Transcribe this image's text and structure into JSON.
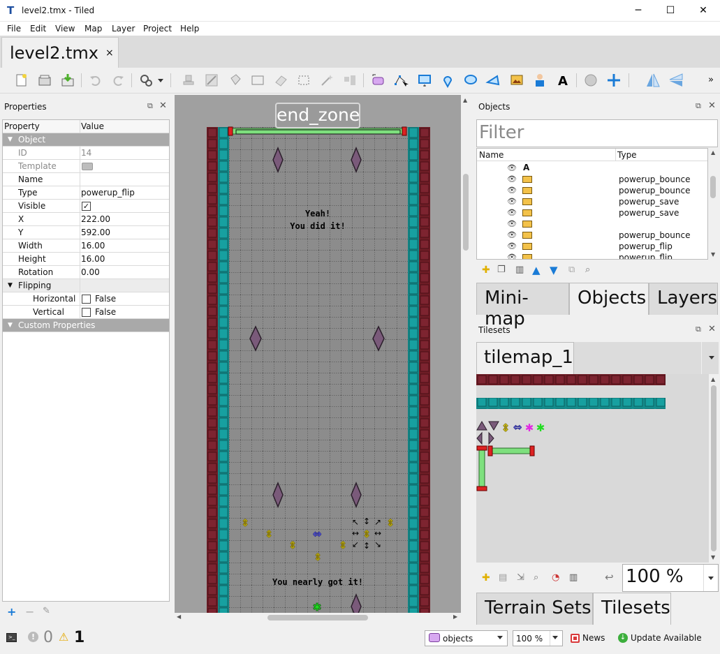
{
  "window": {
    "title": "level2.tmx - Tiled",
    "minimize": "─",
    "maximize": "☐",
    "close": "✕"
  },
  "menu": [
    "File",
    "Edit",
    "View",
    "Map",
    "Layer",
    "Project",
    "Help"
  ],
  "document_tab": {
    "name": "level2.tmx",
    "close": "×"
  },
  "properties_panel": {
    "title": "Properties",
    "columns": {
      "property": "Property",
      "value": "Value"
    },
    "groups": {
      "object": "Object",
      "flipping": "Flipping",
      "custom": "Custom Properties"
    },
    "rows": [
      {
        "key": "ID",
        "value": "14"
      },
      {
        "key": "Template",
        "value": ""
      },
      {
        "key": "Name",
        "value": ""
      },
      {
        "key": "Type",
        "value": "powerup_flip"
      },
      {
        "key": "Visible",
        "value": "✓"
      },
      {
        "key": "X",
        "value": "222.00"
      },
      {
        "key": "Y",
        "value": "592.00"
      },
      {
        "key": "Width",
        "value": "16.00"
      },
      {
        "key": "Height",
        "value": "16.00"
      },
      {
        "key": "Rotation",
        "value": "0.00"
      }
    ],
    "flipping_rows": [
      {
        "key": "Horizontal",
        "value": "False"
      },
      {
        "key": "Vertical",
        "value": "False"
      }
    ]
  },
  "map": {
    "end_zone_label": "end_zone",
    "text_top_1": "Yeah!",
    "text_top_2": "You did it!",
    "text_bottom": "You nearly got it!"
  },
  "objects_panel": {
    "title": "Objects",
    "filter_placeholder": "Filter",
    "columns": {
      "name": "Name",
      "type": "Type"
    },
    "rows": [
      {
        "icon": "text-object-icon",
        "type": ""
      },
      {
        "icon": "image-object-icon",
        "type": "powerup_bounce"
      },
      {
        "icon": "image-object-icon",
        "type": "powerup_bounce"
      },
      {
        "icon": "image-object-icon",
        "type": "powerup_save"
      },
      {
        "icon": "image-object-icon",
        "type": "powerup_save"
      },
      {
        "icon": "image-object-icon",
        "type": ""
      },
      {
        "icon": "image-object-icon",
        "type": "powerup_bounce"
      },
      {
        "icon": "image-object-icon",
        "type": "powerup_flip"
      },
      {
        "icon": "image-object-icon",
        "type": "powerup_flip"
      }
    ],
    "tabs": [
      "Mini-map",
      "Objects",
      "Layers"
    ]
  },
  "tilesets_panel": {
    "title": "Tilesets",
    "tileset_tab": "tilemap_1",
    "zoom": "100 %",
    "tabs": [
      "Terrain Sets",
      "Tilesets"
    ]
  },
  "status": {
    "errors": "0",
    "warnings": "1",
    "layer": "objects",
    "zoom": "100 %",
    "news": "News",
    "update": "Update Available"
  },
  "colors": {
    "accent_selected": "#cce4f7",
    "wall_red": "#6e1d26",
    "wall_teal": "#138c8c",
    "floor_grey": "#8c8c8c",
    "bar_green": "#7ee07e"
  }
}
